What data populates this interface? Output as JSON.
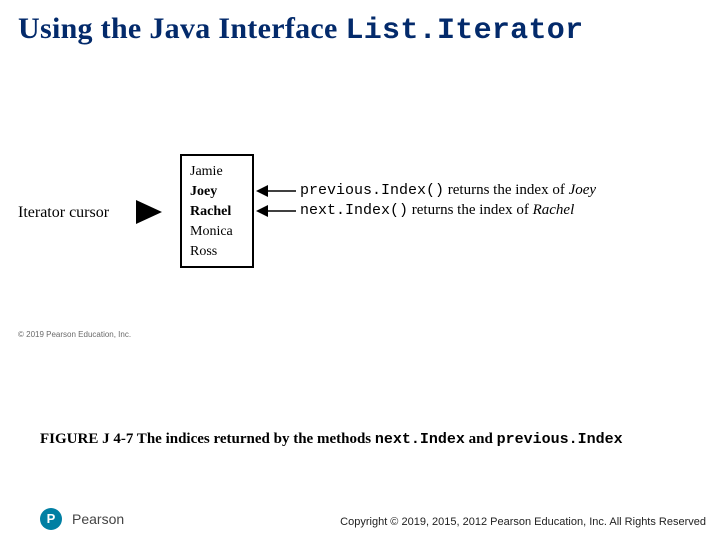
{
  "title": {
    "prefix": "Using the Java Interface ",
    "code": "List.Iterator"
  },
  "figure": {
    "cursor_label": "Iterator cursor",
    "names": [
      "Jamie",
      "Joey",
      "Rachel",
      "Monica",
      "Ross"
    ],
    "prev_method": "previous.Index()",
    "prev_text": " returns the index of ",
    "prev_italic": "Joey",
    "next_method": "next.Index()",
    "next_text": " returns the index of ",
    "next_italic": "Rachel"
  },
  "smallcopy": "© 2019 Pearson Education, Inc.",
  "caption": {
    "lead": "FIGURE J 4-7 The indices returned by the methods ",
    "code1": "next.Index",
    "mid": " and ",
    "code2": "previous.Index"
  },
  "footer": {
    "logo_letter": "P",
    "logo_name": "Pearson",
    "copyright": "Copyright © 2019, 2015, 2012 Pearson Education, Inc. All Rights Reserved"
  }
}
